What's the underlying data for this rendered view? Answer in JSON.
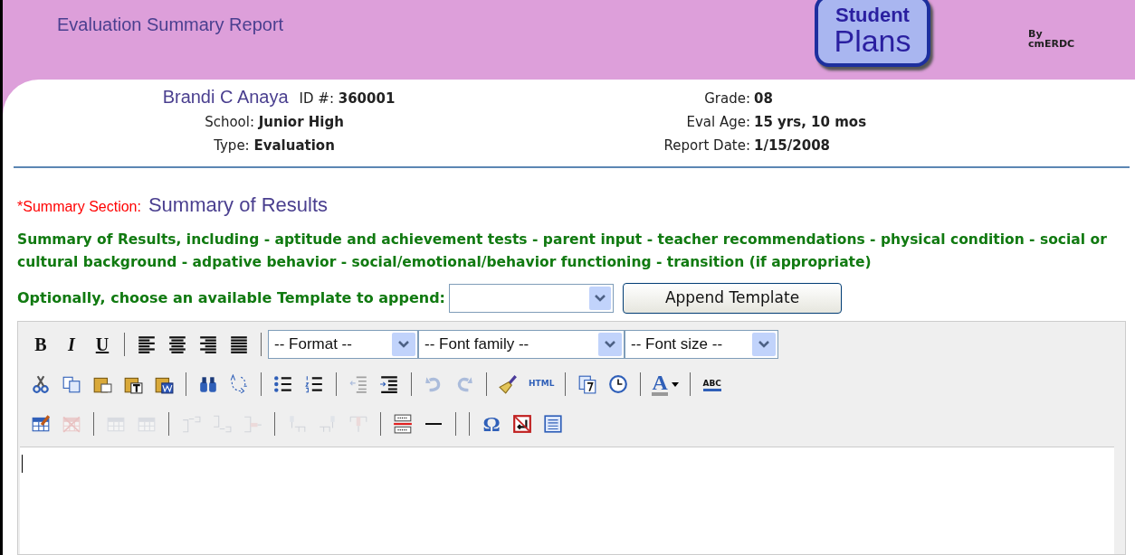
{
  "header": {
    "title": "Evaluation Summary Report",
    "logo_line_1": "Student",
    "logo_line_2": "Plans",
    "logo_by": "By",
    "logo_company": "cmERDC"
  },
  "student": {
    "name": "Brandi C Anaya",
    "id_label": "ID #:",
    "id": "360001",
    "school_label": "School:",
    "school": "Junior High",
    "type_label": "Type:",
    "type": "Evaluation",
    "grade_label": "Grade:",
    "grade": "08",
    "age_label": "Eval Age:",
    "age": "15 yrs, 10 mos",
    "date_label": "Report Date:",
    "date": "1/15/2008"
  },
  "section": {
    "required_label": "*Summary Section:",
    "name": "Summary of Results",
    "instructions": "Summary of Results, including - aptitude and achievement tests - parent input - teacher recommendations - physical condition - social or cultural background - adpative behavior - social/emotional/behavior functioning - transition (if appropriate)"
  },
  "template": {
    "label": "Optionally, choose an available Template to append:",
    "button": "Append Template"
  },
  "toolbar": [
    [
      {
        "kind": "button",
        "label": "B",
        "disabled": false
      },
      {
        "kind": "button",
        "label": "I",
        "disabled": false
      },
      {
        "kind": "button",
        "label": "U",
        "disabled": false
      },
      {
        "kind": "separator"
      },
      {
        "kind": "button",
        "disabled": false
      },
      {
        "kind": "button",
        "disabled": false
      },
      {
        "kind": "button",
        "disabled": false
      },
      {
        "kind": "button",
        "disabled": false
      },
      {
        "kind": "separator"
      },
      {
        "kind": "select",
        "value": "-- Format --"
      },
      {
        "kind": "select",
        "value": "-- Font family --"
      },
      {
        "kind": "select",
        "value": "-- Font size --"
      }
    ],
    [
      {
        "kind": "button",
        "disabled": false
      },
      {
        "kind": "button",
        "disabled": false
      },
      {
        "kind": "button",
        "disabled": false
      },
      {
        "kind": "button",
        "disabled": false
      },
      {
        "kind": "button",
        "disabled": false
      },
      {
        "kind": "separator"
      },
      {
        "kind": "button",
        "disabled": false
      },
      {
        "kind": "button",
        "disabled": false
      },
      {
        "kind": "separator"
      },
      {
        "kind": "button",
        "disabled": false
      },
      {
        "kind": "button",
        "disabled": false
      },
      {
        "kind": "separator"
      },
      {
        "kind": "button",
        "disabled": true
      },
      {
        "kind": "button",
        "disabled": false
      },
      {
        "kind": "separator"
      },
      {
        "kind": "button",
        "disabled": true
      },
      {
        "kind": "button",
        "disabled": true
      },
      {
        "kind": "separator"
      },
      {
        "kind": "button",
        "disabled": false
      },
      {
        "kind": "button",
        "label": "HTML",
        "disabled": false
      },
      {
        "kind": "separator"
      },
      {
        "kind": "button",
        "disabled": false
      },
      {
        "kind": "button",
        "disabled": false
      },
      {
        "kind": "separator"
      },
      {
        "kind": "button",
        "label": "A",
        "disabled": false
      },
      {
        "kind": "separator"
      },
      {
        "kind": "button",
        "label": "ABC",
        "disabled": false
      }
    ],
    [
      {
        "kind": "button",
        "disabled": false
      },
      {
        "kind": "button",
        "disabled": true
      },
      {
        "kind": "separator"
      },
      {
        "kind": "button",
        "disabled": true
      },
      {
        "kind": "button",
        "disabled": true
      },
      {
        "kind": "separator"
      },
      {
        "kind": "button",
        "disabled": true
      },
      {
        "kind": "button",
        "disabled": true
      },
      {
        "kind": "button",
        "disabled": true
      },
      {
        "kind": "separator"
      },
      {
        "kind": "button",
        "disabled": true
      },
      {
        "kind": "button",
        "disabled": true
      },
      {
        "kind": "button",
        "disabled": true
      },
      {
        "kind": "separator"
      },
      {
        "kind": "button",
        "disabled": false
      },
      {
        "kind": "button",
        "disabled": false
      },
      {
        "kind": "separator"
      },
      {
        "kind": "separator"
      },
      {
        "kind": "button",
        "label": "Ω",
        "disabled": false
      },
      {
        "kind": "button",
        "disabled": false
      },
      {
        "kind": "button",
        "disabled": false
      }
    ]
  ]
}
